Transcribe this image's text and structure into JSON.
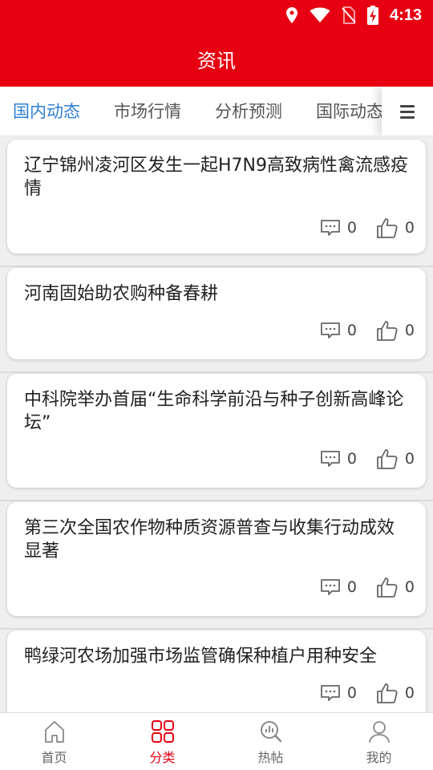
{
  "status_bar": {
    "time": "4:13"
  },
  "header": {
    "title": "资讯"
  },
  "tabs": [
    {
      "label": "国内动态",
      "active": true
    },
    {
      "label": "市场行情",
      "active": false
    },
    {
      "label": "分析预测",
      "active": false
    },
    {
      "label": "国际动态",
      "active": false
    }
  ],
  "articles": [
    {
      "title": "辽宁锦州凌河区发生一起H7N9高致病性禽流感疫情",
      "comments": "0",
      "likes": "0"
    },
    {
      "title": "河南固始助农购种备春耕",
      "comments": "0",
      "likes": "0"
    },
    {
      "title": "中科院举办首届“生命科学前沿与种子创新高峰论坛”",
      "comments": "0",
      "likes": "0"
    },
    {
      "title": "第三次全国农作物种质资源普查与收集行动成效显著",
      "comments": "0",
      "likes": "0"
    },
    {
      "title": "鸭绿河农场加强市场监管确保种植户用种安全",
      "comments": "0",
      "likes": "0"
    }
  ],
  "bottom_nav": [
    {
      "label": "首页",
      "icon": "home-icon",
      "active": false
    },
    {
      "label": "分类",
      "icon": "grid-icon",
      "active": true
    },
    {
      "label": "热帖",
      "icon": "search-chart-icon",
      "active": false
    },
    {
      "label": "我的",
      "icon": "user-icon",
      "active": false
    }
  ],
  "colors": {
    "brand_red": "#e60012",
    "tab_active_blue": "#2f7fd6"
  }
}
